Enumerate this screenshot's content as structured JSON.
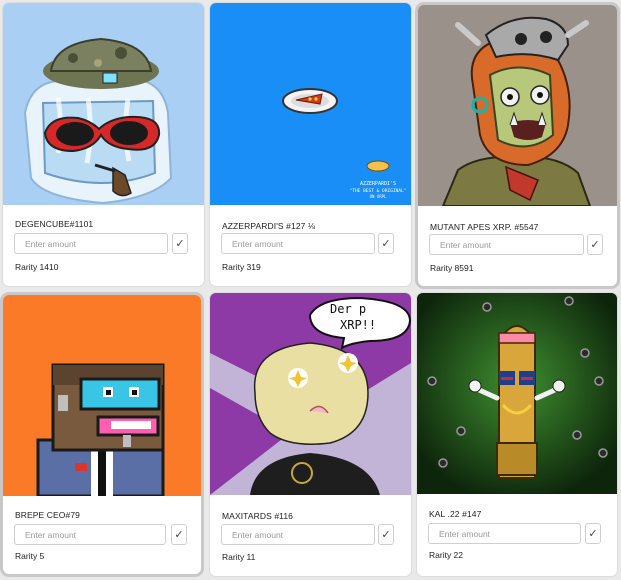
{
  "cards": [
    {
      "title": "DEGENCUBE#1101",
      "placeholder": "Enter amount",
      "confirm": "✓",
      "rarity_label": "Rarity 1410",
      "image": "helmeted-ice-cube-with-sunglasses-and-pipe",
      "bg": "#a9cff5"
    },
    {
      "title": "AZZERPARDI'S #127 ⅛",
      "placeholder": "Enter amount",
      "confirm": "✓",
      "rarity_label": "Rarity 319",
      "image": "pixel-pizza-plate-on-blue",
      "bg": "#1a8ef7",
      "art_text": {
        "brand": "AZZERPARDI'S",
        "tagline": "\"THE BEST & ORIGINAL\"",
        "small": "ON XRPL"
      }
    },
    {
      "title": "MUTANT APES XRP. #5547",
      "placeholder": "Enter amount",
      "confirm": "✓",
      "rarity_label": "Rarity 8591",
      "image": "mutant-ape-with-skull-helmet",
      "bg": "#9b918b"
    },
    {
      "title": "BREPE CEO#79",
      "placeholder": "Enter amount",
      "confirm": "✓",
      "rarity_label": "Rarity 5",
      "image": "pixel-character-with-cyan-glasses",
      "bg": "#fb7a27"
    },
    {
      "title": "MAXITARDS #116",
      "placeholder": "Enter amount",
      "confirm": "✓",
      "rarity_label": "Rarity 11",
      "image": "bald-character-with-star-eyes",
      "bg": "#c2b4d6",
      "art_text": {
        "speech_line1": "Der p",
        "speech_line2": "XRP!!"
      }
    },
    {
      "title": "KAL .22 #147",
      "placeholder": "Enter amount",
      "confirm": "✓",
      "rarity_label": "Rarity 22",
      "image": "bullet-character-with-flag-glasses",
      "bg": "#1f4d1b"
    }
  ],
  "colors": {
    "accent_border": "#c8c8c8",
    "card_bg": "#ffffff",
    "page_bg": "#e9e9e9"
  }
}
